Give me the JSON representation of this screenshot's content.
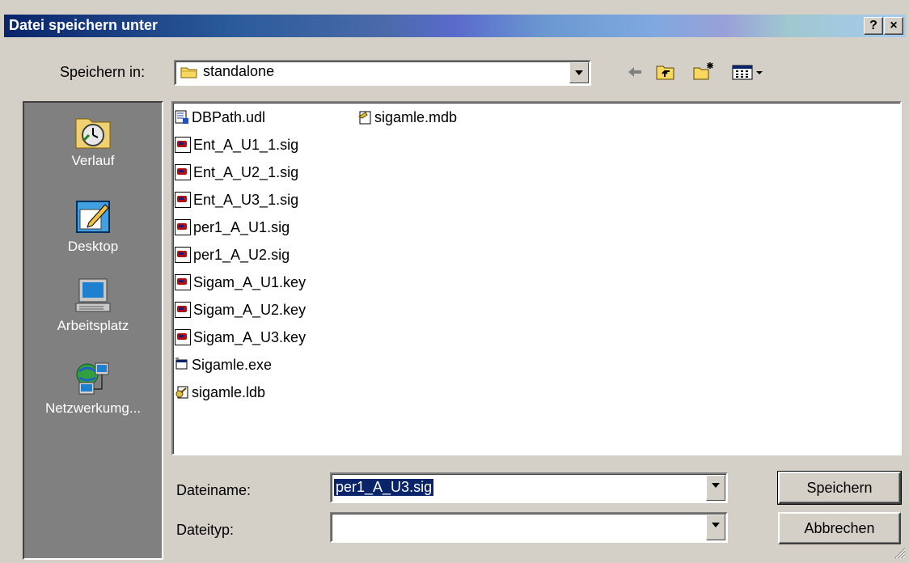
{
  "window": {
    "title": "Datei speichern unter",
    "help_button": "?",
    "close_button": "×"
  },
  "save_in": {
    "label": "Speichern in:",
    "value": "standalone"
  },
  "toolbar": {
    "back_icon": "back-arrow-icon",
    "up_icon": "up-folder-icon",
    "new_folder_icon": "new-folder-icon",
    "view_icon": "view-menu-icon"
  },
  "places": [
    {
      "label": "Verlauf",
      "icon": "history-icon"
    },
    {
      "label": "Desktop",
      "icon": "desktop-icon"
    },
    {
      "label": "Arbeitsplatz",
      "icon": "my-computer-icon"
    },
    {
      "label": "Netzwerkumg...",
      "icon": "network-icon"
    }
  ],
  "files": {
    "col1": [
      {
        "name": "DBPath.udl",
        "icon": "udl-file-icon"
      },
      {
        "name": "Ent_A_U1_1.sig",
        "icon": "sig-file-icon"
      },
      {
        "name": "Ent_A_U2_1.sig",
        "icon": "sig-file-icon"
      },
      {
        "name": "Ent_A_U3_1.sig",
        "icon": "sig-file-icon"
      },
      {
        "name": "per1_A_U1.sig",
        "icon": "sig-file-icon"
      },
      {
        "name": "per1_A_U2.sig",
        "icon": "sig-file-icon"
      },
      {
        "name": "Sigam_A_U1.key",
        "icon": "sig-file-icon"
      },
      {
        "name": "Sigam_A_U2.key",
        "icon": "sig-file-icon"
      },
      {
        "name": "Sigam_A_U3.key",
        "icon": "sig-file-icon"
      },
      {
        "name": "Sigamle.exe",
        "icon": "exe-file-icon"
      },
      {
        "name": "sigamle.ldb",
        "icon": "ldb-file-icon"
      }
    ],
    "col2": [
      {
        "name": "sigamle.mdb",
        "icon": "mdb-file-icon"
      }
    ]
  },
  "filename": {
    "label": "Dateiname:",
    "value": "per1_A_U3.sig"
  },
  "filetype": {
    "label": "Dateityp:",
    "value": ""
  },
  "buttons": {
    "save": "Speichern",
    "cancel": "Abbrechen"
  },
  "colors": {
    "title_start": "#0a246a",
    "title_end": "#a6caf0",
    "dialog_bg": "#d4d0c8",
    "places_bg": "#808080",
    "selection": "#0a246a"
  }
}
